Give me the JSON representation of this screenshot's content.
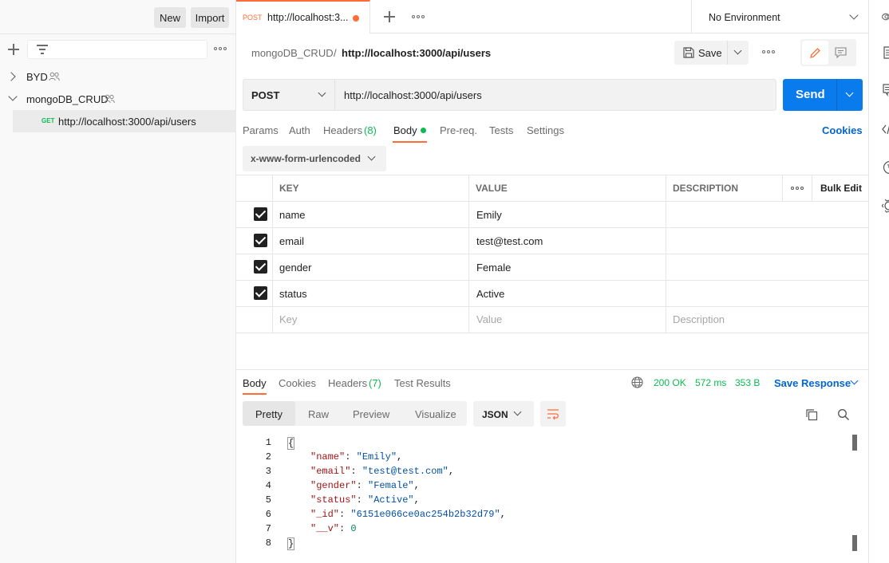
{
  "sidebar": {
    "new_label": "New",
    "import_label": "Import",
    "collections": [
      {
        "name": "BYD"
      },
      {
        "name": "mongoDB_CRUD"
      }
    ],
    "request": {
      "method": "GET",
      "url": "http://localhost:3000/api/users"
    }
  },
  "tabbar": {
    "tab": {
      "method": "POST",
      "title": "http://localhost:3..."
    },
    "environment": "No Environment"
  },
  "breadcrumb": {
    "collection": "mongoDB_CRUD",
    "separator": "/",
    "request": "http://localhost:3000/api/users"
  },
  "toolbar": {
    "save_label": "Save"
  },
  "request": {
    "method": "POST",
    "url": "http://localhost:3000/api/users",
    "send_label": "Send",
    "tabs": {
      "params": "Params",
      "auth": "Auth",
      "headers": "Headers",
      "headers_count": "(8)",
      "body": "Body",
      "prereq": "Pre-req.",
      "tests": "Tests",
      "settings": "Settings"
    },
    "cookies_label": "Cookies",
    "body_mode": "x-www-form-urlencoded",
    "table": {
      "headers": {
        "key": "KEY",
        "value": "VALUE",
        "description": "DESCRIPTION",
        "bulk_edit": "Bulk Edit"
      },
      "rows": [
        {
          "key": "name",
          "value": "Emily"
        },
        {
          "key": "email",
          "value": "test@test.com"
        },
        {
          "key": "gender",
          "value": "Female"
        },
        {
          "key": "status",
          "value": "Active"
        }
      ],
      "placeholders": {
        "key": "Key",
        "value": "Value",
        "description": "Description"
      }
    }
  },
  "response": {
    "tabs": {
      "body": "Body",
      "cookies": "Cookies",
      "headers": "Headers",
      "headers_count": "(7)",
      "test_results": "Test Results"
    },
    "status": "200 OK",
    "time": "572 ms",
    "size": "353 B",
    "save_label": "Save Response",
    "views": {
      "pretty": "Pretty",
      "raw": "Raw",
      "preview": "Preview",
      "visualize": "Visualize"
    },
    "format": "JSON",
    "code_lines": [
      "1",
      "2",
      "3",
      "4",
      "5",
      "6",
      "7",
      "8"
    ],
    "json": {
      "open": "{",
      "close": "}",
      "fields": [
        {
          "k": "\"name\"",
          "v": "\"Emily\"",
          "comma": ","
        },
        {
          "k": "\"email\"",
          "v": "\"test@test.com\"",
          "comma": ","
        },
        {
          "k": "\"gender\"",
          "v": "\"Female\"",
          "comma": ","
        },
        {
          "k": "\"status\"",
          "v": "\"Active\"",
          "comma": ","
        },
        {
          "k": "\"_id\"",
          "v": "\"6151e066ce0ac254b2b32d79\"",
          "comma": ","
        },
        {
          "k": "\"__v\"",
          "v": "0",
          "comma": ""
        }
      ]
    }
  },
  "colors": {
    "accent": "#ff6c37",
    "send": "#097bed",
    "status_ok": "#0cbb52",
    "link": "#0265d2"
  }
}
